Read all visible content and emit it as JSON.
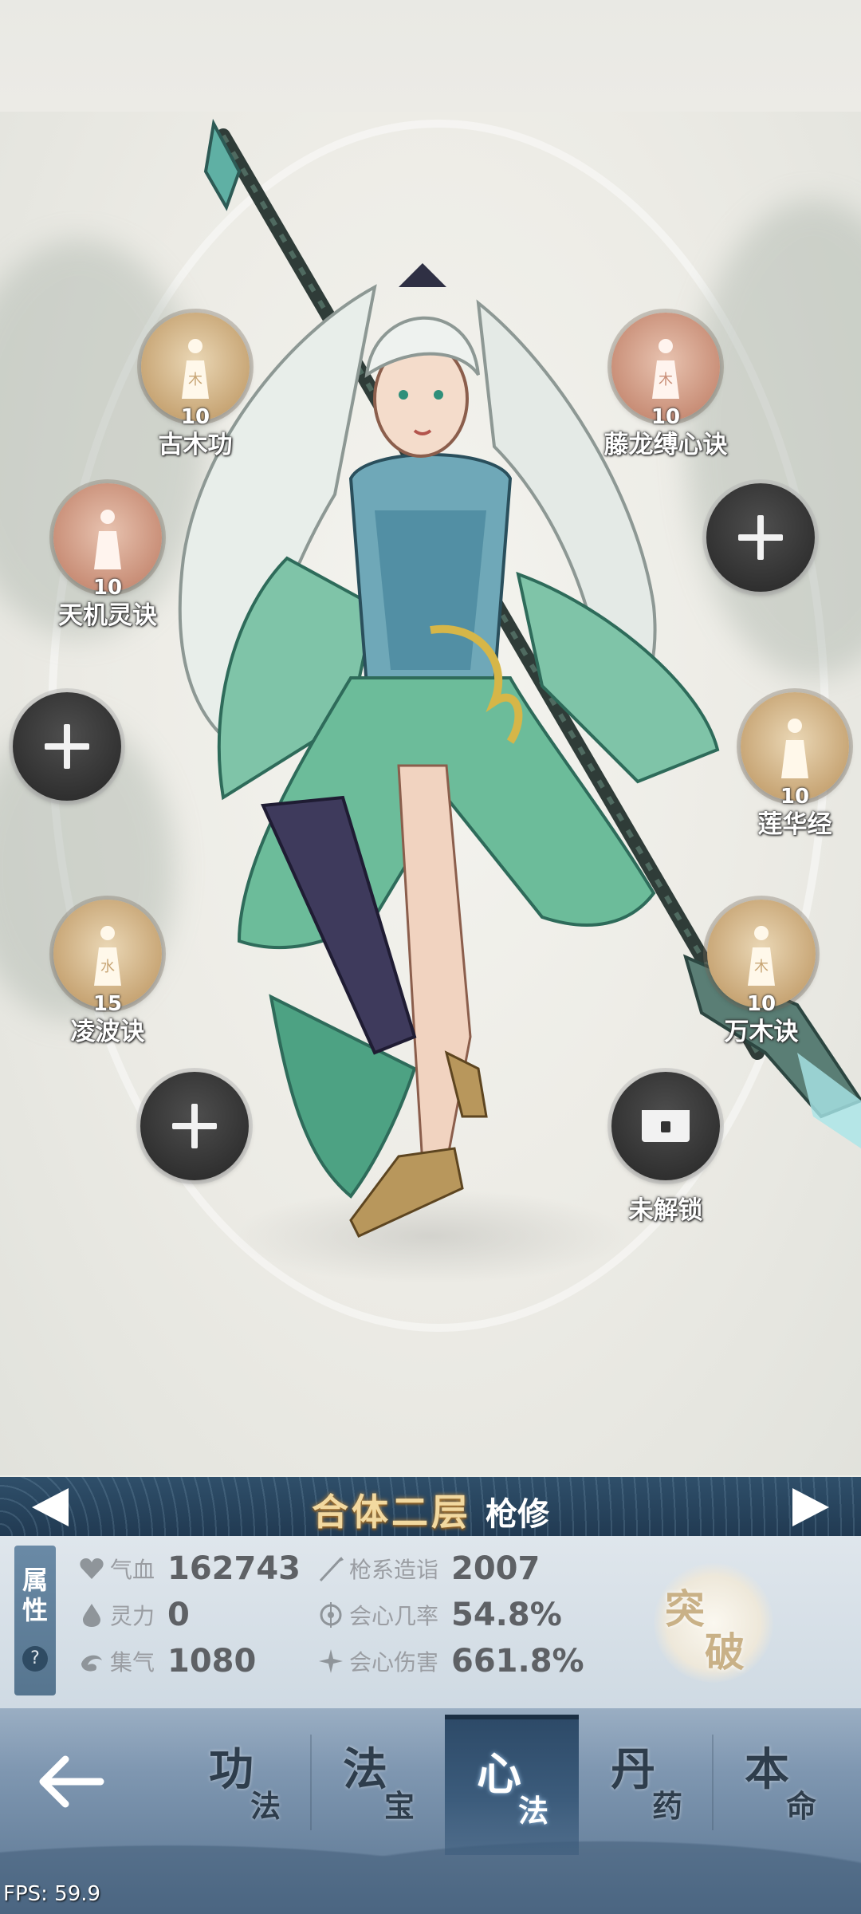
{
  "skills": {
    "gumu": {
      "level": "10",
      "name": "古木功",
      "glyph": "木"
    },
    "tenglong": {
      "level": "10",
      "name": "藤龙缚心诀",
      "glyph": "木"
    },
    "tianji": {
      "level": "10",
      "name": "天机灵诀",
      "glyph": ""
    },
    "lianhua": {
      "level": "10",
      "name": "莲华经",
      "glyph": ""
    },
    "lingbo": {
      "level": "15",
      "name": "凌波诀",
      "glyph": "水"
    },
    "wanmu": {
      "level": "10",
      "name": "万木诀",
      "glyph": "木"
    },
    "locked": {
      "name": "未解锁"
    }
  },
  "realm": {
    "stage": "合体二层",
    "path": "枪修"
  },
  "stats": {
    "tab": {
      "line1": "属",
      "line2": "性",
      "help": "?"
    },
    "hp": {
      "label": "气血",
      "value": "162743"
    },
    "spirit": {
      "label": "灵力",
      "value": "0"
    },
    "qi": {
      "label": "集气",
      "value": "1080"
    },
    "spear": {
      "label": "枪系造诣",
      "value": "2007"
    },
    "crit_rate": {
      "label": "会心几率",
      "value": "54.8%"
    },
    "crit_dmg": {
      "label": "会心伤害",
      "value": "661.8%"
    },
    "breakthrough": {
      "c1": "突",
      "c2": "破"
    }
  },
  "nav": {
    "tabs": [
      {
        "big": "功",
        "small": "法"
      },
      {
        "big": "法",
        "small": "宝"
      },
      {
        "big": "心",
        "small": "法"
      },
      {
        "big": "丹",
        "small": "药"
      },
      {
        "big": "本",
        "small": "命"
      }
    ],
    "active_index": 2
  },
  "fps": "FPS: 59.9",
  "colors": {
    "realm_bar": "#2a4660",
    "stage_text": "#f2d9a0",
    "panel": "#d8e1e8",
    "nav": "#7f97b1"
  },
  "icons": {
    "add": "plus-icon",
    "locked": "chest-lock-icon",
    "back": "arrow-left-icon"
  }
}
